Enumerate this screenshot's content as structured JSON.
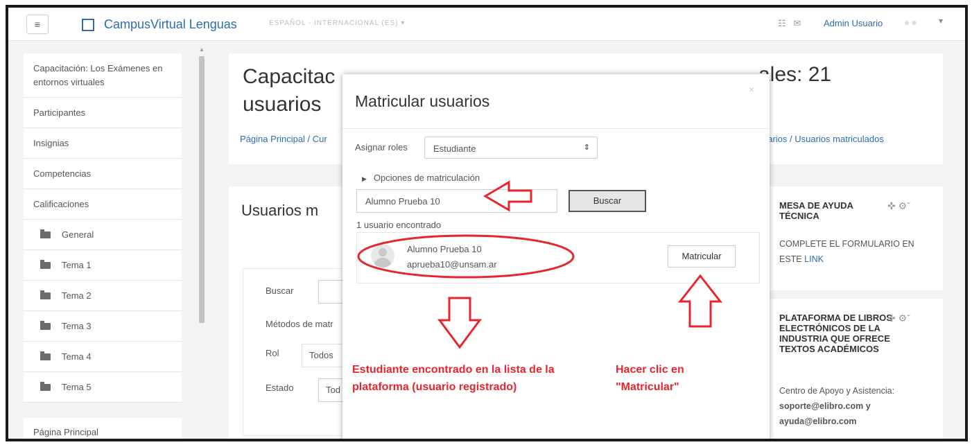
{
  "navbar": {
    "menu_glyph": "≡",
    "site_title": "CampusVirtual Lenguas",
    "language": "ESPAÑOL - INTERNACIONAL (ES) ▾",
    "user": "Admin Usuario"
  },
  "sidebar": {
    "items": [
      {
        "label": "Capacitación: Los Exámenes en entornos virtuales"
      },
      {
        "label": "Participantes"
      },
      {
        "label": "Insignias"
      },
      {
        "label": "Competencias"
      },
      {
        "label": "Calificaciones"
      },
      {
        "label": "General"
      },
      {
        "label": "Tema 1"
      },
      {
        "label": "Tema 2"
      },
      {
        "label": "Tema 3"
      },
      {
        "label": "Tema 4"
      },
      {
        "label": "Tema 5"
      }
    ],
    "bottom": "Página Principal"
  },
  "header": {
    "title_line1": "Capacitac",
    "title_line2": "usuarios",
    "title_right": "ales: 21",
    "breadcrumb_left": "Página Principal / Cur",
    "breadcrumb_right": "uarios / Usuarios matriculados"
  },
  "content": {
    "title": "Usuarios m",
    "search_label": "Buscar",
    "methods_label": "Métodos de matr",
    "role_label": "Rol",
    "role_value": "Todos",
    "state_label": "Estado",
    "state_value": "Tod"
  },
  "blocks": {
    "help": {
      "title": "MESA DE AYUDA TÉCNICA",
      "text": "COMPLETE EL FORMULARIO EN ESTE",
      "link": "LINK"
    },
    "books": {
      "title": "PLATAFORMA DE LIBROS ELECTRÓNICOS DE LA INDUSTRIA QUE OFRECE TEXTOS ACADÉMICOS",
      "text1": "Centro de Apoyo y Asistencia:",
      "email1": "soporte@elibro.com",
      "text2": "y",
      "email2": "ayuda@elibro.com"
    }
  },
  "modal": {
    "title": "Matricular usuarios",
    "close": "×",
    "assign_roles_label": "Asignar roles",
    "role_selected": "Estudiante",
    "enrol_options": "Opciones de matriculación",
    "search_value": "Alumno Prueba 10",
    "search_button": "Buscar",
    "found_count": "1 usuario encontrado",
    "result": {
      "name": "Alumno Prueba 10",
      "email": "aprueba10@unsam.ar",
      "enrol_button": "Matricular"
    }
  },
  "annotations": {
    "left_note": "Estudiante encontrado en la lista de la plataforma (usuario registrado)",
    "right_note": "Hacer clic en \"Matricular\"",
    "color": "#e8242c"
  }
}
